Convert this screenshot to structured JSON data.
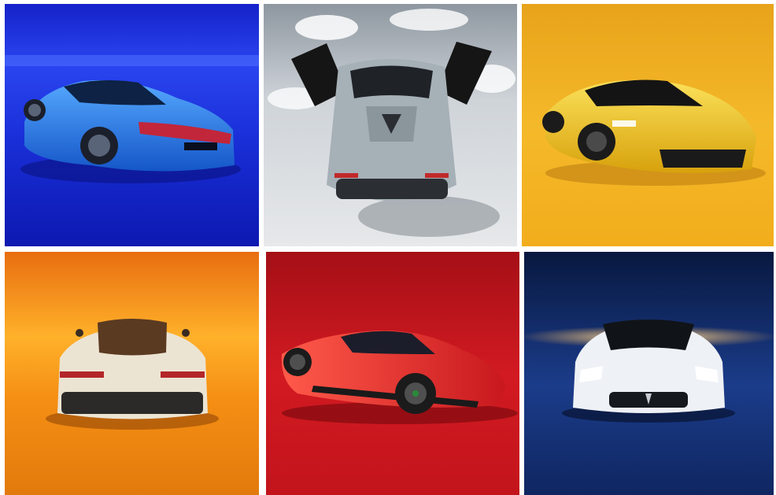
{
  "gallery": {
    "tiles": [
      {
        "subject": "blue-sports-car-rear-three-quarter",
        "background": "#1f2fd6",
        "car_color": "#2a7fe8"
      },
      {
        "subject": "grey-convertible-top-view-doors-open",
        "background": "#c7ccd1",
        "car_color": "#9aa6ad"
      },
      {
        "subject": "yellow-sports-car-front-three-quarter",
        "background": "#f2b21f",
        "car_color": "#f0c419"
      },
      {
        "subject": "white-sports-car-rear-view",
        "background": "#f08a17",
        "car_color": "#e9e2d2"
      },
      {
        "subject": "red-sports-car-side-view",
        "background": "#c8141c",
        "car_color": "#e0252a"
      },
      {
        "subject": "white-sports-car-front-view",
        "background": "#0f2c6e",
        "car_color": "#eef1f5"
      }
    ]
  }
}
